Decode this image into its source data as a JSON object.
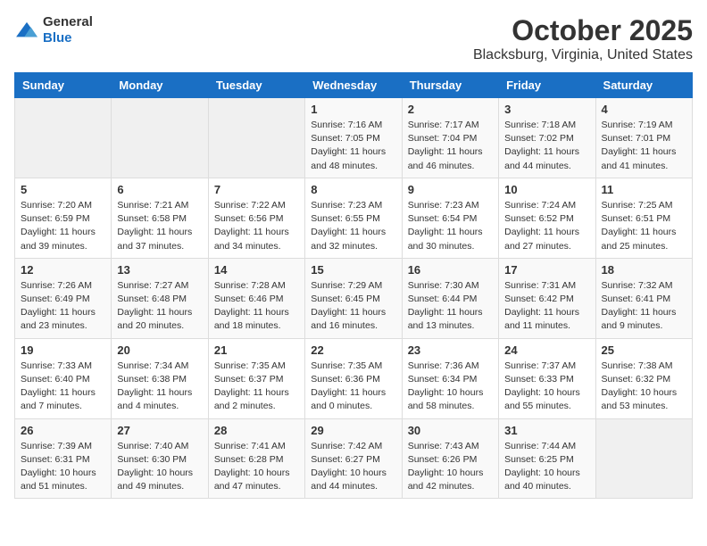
{
  "logo": {
    "general": "General",
    "blue": "Blue"
  },
  "title": "October 2025",
  "location": "Blacksburg, Virginia, United States",
  "days_of_week": [
    "Sunday",
    "Monday",
    "Tuesday",
    "Wednesday",
    "Thursday",
    "Friday",
    "Saturday"
  ],
  "weeks": [
    [
      {
        "day": "",
        "info": ""
      },
      {
        "day": "",
        "info": ""
      },
      {
        "day": "",
        "info": ""
      },
      {
        "day": "1",
        "info": "Sunrise: 7:16 AM\nSunset: 7:05 PM\nDaylight: 11 hours and 48 minutes."
      },
      {
        "day": "2",
        "info": "Sunrise: 7:17 AM\nSunset: 7:04 PM\nDaylight: 11 hours and 46 minutes."
      },
      {
        "day": "3",
        "info": "Sunrise: 7:18 AM\nSunset: 7:02 PM\nDaylight: 11 hours and 44 minutes."
      },
      {
        "day": "4",
        "info": "Sunrise: 7:19 AM\nSunset: 7:01 PM\nDaylight: 11 hours and 41 minutes."
      }
    ],
    [
      {
        "day": "5",
        "info": "Sunrise: 7:20 AM\nSunset: 6:59 PM\nDaylight: 11 hours and 39 minutes."
      },
      {
        "day": "6",
        "info": "Sunrise: 7:21 AM\nSunset: 6:58 PM\nDaylight: 11 hours and 37 minutes."
      },
      {
        "day": "7",
        "info": "Sunrise: 7:22 AM\nSunset: 6:56 PM\nDaylight: 11 hours and 34 minutes."
      },
      {
        "day": "8",
        "info": "Sunrise: 7:23 AM\nSunset: 6:55 PM\nDaylight: 11 hours and 32 minutes."
      },
      {
        "day": "9",
        "info": "Sunrise: 7:23 AM\nSunset: 6:54 PM\nDaylight: 11 hours and 30 minutes."
      },
      {
        "day": "10",
        "info": "Sunrise: 7:24 AM\nSunset: 6:52 PM\nDaylight: 11 hours and 27 minutes."
      },
      {
        "day": "11",
        "info": "Sunrise: 7:25 AM\nSunset: 6:51 PM\nDaylight: 11 hours and 25 minutes."
      }
    ],
    [
      {
        "day": "12",
        "info": "Sunrise: 7:26 AM\nSunset: 6:49 PM\nDaylight: 11 hours and 23 minutes."
      },
      {
        "day": "13",
        "info": "Sunrise: 7:27 AM\nSunset: 6:48 PM\nDaylight: 11 hours and 20 minutes."
      },
      {
        "day": "14",
        "info": "Sunrise: 7:28 AM\nSunset: 6:46 PM\nDaylight: 11 hours and 18 minutes."
      },
      {
        "day": "15",
        "info": "Sunrise: 7:29 AM\nSunset: 6:45 PM\nDaylight: 11 hours and 16 minutes."
      },
      {
        "day": "16",
        "info": "Sunrise: 7:30 AM\nSunset: 6:44 PM\nDaylight: 11 hours and 13 minutes."
      },
      {
        "day": "17",
        "info": "Sunrise: 7:31 AM\nSunset: 6:42 PM\nDaylight: 11 hours and 11 minutes."
      },
      {
        "day": "18",
        "info": "Sunrise: 7:32 AM\nSunset: 6:41 PM\nDaylight: 11 hours and 9 minutes."
      }
    ],
    [
      {
        "day": "19",
        "info": "Sunrise: 7:33 AM\nSunset: 6:40 PM\nDaylight: 11 hours and 7 minutes."
      },
      {
        "day": "20",
        "info": "Sunrise: 7:34 AM\nSunset: 6:38 PM\nDaylight: 11 hours and 4 minutes."
      },
      {
        "day": "21",
        "info": "Sunrise: 7:35 AM\nSunset: 6:37 PM\nDaylight: 11 hours and 2 minutes."
      },
      {
        "day": "22",
        "info": "Sunrise: 7:35 AM\nSunset: 6:36 PM\nDaylight: 11 hours and 0 minutes."
      },
      {
        "day": "23",
        "info": "Sunrise: 7:36 AM\nSunset: 6:34 PM\nDaylight: 10 hours and 58 minutes."
      },
      {
        "day": "24",
        "info": "Sunrise: 7:37 AM\nSunset: 6:33 PM\nDaylight: 10 hours and 55 minutes."
      },
      {
        "day": "25",
        "info": "Sunrise: 7:38 AM\nSunset: 6:32 PM\nDaylight: 10 hours and 53 minutes."
      }
    ],
    [
      {
        "day": "26",
        "info": "Sunrise: 7:39 AM\nSunset: 6:31 PM\nDaylight: 10 hours and 51 minutes."
      },
      {
        "day": "27",
        "info": "Sunrise: 7:40 AM\nSunset: 6:30 PM\nDaylight: 10 hours and 49 minutes."
      },
      {
        "day": "28",
        "info": "Sunrise: 7:41 AM\nSunset: 6:28 PM\nDaylight: 10 hours and 47 minutes."
      },
      {
        "day": "29",
        "info": "Sunrise: 7:42 AM\nSunset: 6:27 PM\nDaylight: 10 hours and 44 minutes."
      },
      {
        "day": "30",
        "info": "Sunrise: 7:43 AM\nSunset: 6:26 PM\nDaylight: 10 hours and 42 minutes."
      },
      {
        "day": "31",
        "info": "Sunrise: 7:44 AM\nSunset: 6:25 PM\nDaylight: 10 hours and 40 minutes."
      },
      {
        "day": "",
        "info": ""
      }
    ]
  ]
}
